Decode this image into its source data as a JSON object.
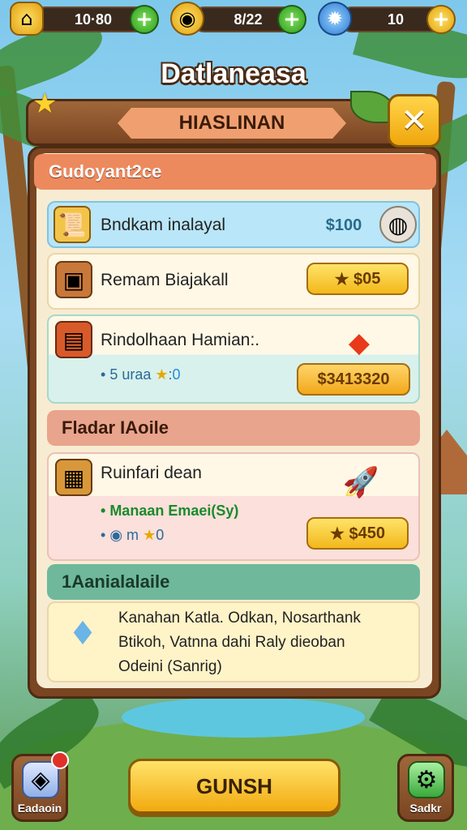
{
  "resources": [
    {
      "icon": "home-icon",
      "value": "10·80"
    },
    {
      "icon": "coin-pouch-icon",
      "value": "8/22"
    },
    {
      "icon": "gear-gem-icon",
      "value": "10"
    }
  ],
  "window_title": "Datlaneasa",
  "ribbon_title": "HIASLINAN",
  "sections": [
    {
      "heading": "Gudoyant2ce"
    },
    {
      "heading": "Fladar IAoile"
    },
    {
      "heading": "1Aanialalaile"
    }
  ],
  "items": {
    "item1": {
      "label": "Bndkam inalayal",
      "price": "$100",
      "icon": "scroll-icon",
      "reward_icon": "rock-icon"
    },
    "item2": {
      "label": "Remam Biajakall",
      "price": "05",
      "icon": "chest-icon"
    },
    "item3": {
      "label": "Rindolhaan Hamian:.",
      "sub": "5 uraa",
      "sub_suffix": "0",
      "price": "$3413320",
      "icon": "book-icon",
      "reward_icon": "ruby-icon"
    },
    "item4": {
      "label": "Ruinfari dean",
      "green_line": "Manaan Emaei(Sy)",
      "sub": "m",
      "sub_suffix": "0",
      "price": "450",
      "icon": "crate-icon",
      "reward_icon": "rocket-icon"
    }
  },
  "description": {
    "lines": [
      "Kanahan Katla. Odkan, Nosarthank",
      "Btikoh, Vatnna dahi Raly dieoban",
      "Odeini (Sanrig)"
    ],
    "icon": "crystal-icon"
  },
  "main_button": "GUNSH",
  "corner_buttons": [
    {
      "label": "Eadaoin",
      "icon": "gem-chest-icon"
    },
    {
      "label": "Sadkr",
      "icon": "robot-icon"
    }
  ],
  "colors": {
    "section1": "#ec8a5e",
    "section2": "#e8a48c",
    "section3": "#6fb89c",
    "card_blue": "#b9e6f8",
    "card_teal": "#d8f1ec",
    "card_pink": "#fbe0dc",
    "gold": "#f2b81a"
  }
}
